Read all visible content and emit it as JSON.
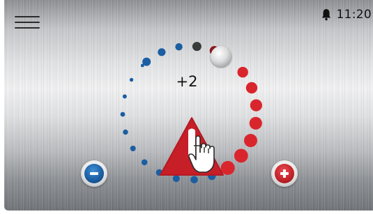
{
  "status_bar": {
    "time": "11:20",
    "icons": [
      "bell-icon"
    ]
  },
  "menu": {
    "icon": "hamburger-menu-icon"
  },
  "thermostat": {
    "offset_display": "+2",
    "setpoint_fraction": 0.55,
    "ring_dots": {
      "total": 24,
      "colors": {
        "cold": "#1b5ea2",
        "neutral": "#3a3a3a",
        "warm_dark": "#8a1a1e",
        "warm": "#d9262d"
      }
    },
    "decrease_icon": "minus-icon",
    "increase_icon": "plus-icon",
    "center_icon": "warning-hand-icon"
  },
  "colors": {
    "accent_red": "#c8202a",
    "accent_blue": "#1b5ea2"
  }
}
